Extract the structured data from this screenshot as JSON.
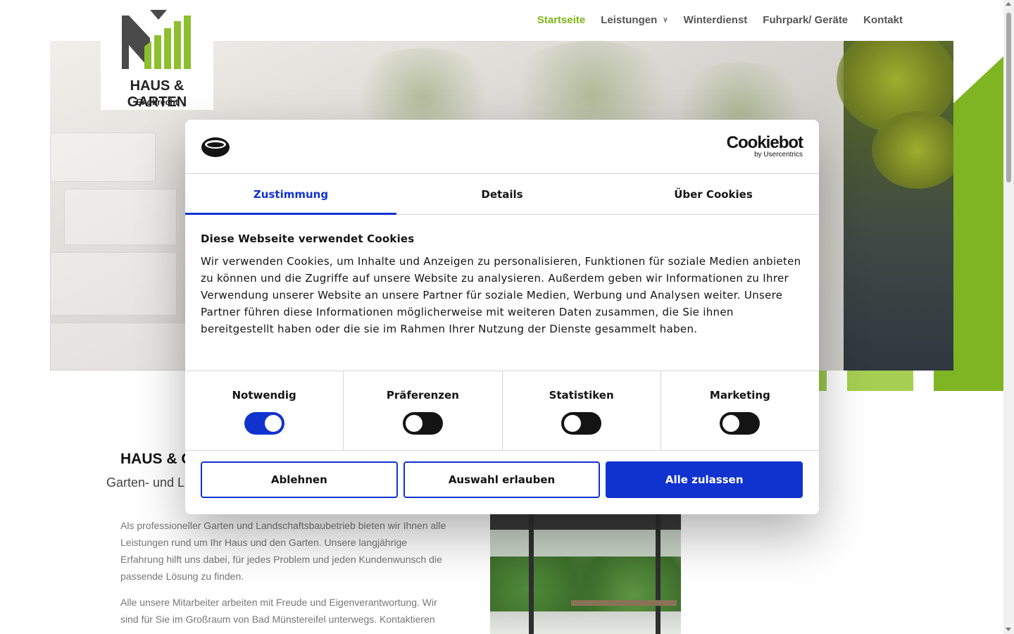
{
  "site": {
    "logo_title": "HAUS & GARTEN",
    "logo_subtitle": "Engbrecht",
    "nav": {
      "home": "Startseite",
      "services": "Leistungen",
      "winter": "Winterdienst",
      "fleet": "Fuhrpark/ Geräte",
      "contact": "Kontakt"
    },
    "accent_color": "#7cb518"
  },
  "page": {
    "heading": "HAUS & G",
    "subheading": "Garten- und L",
    "paragraph1": "Als professioneller Garten und Landschaftsbaubetrieb bieten wir Ihnen alle Leistungen rund um Ihr Haus und den Garten. Unsere langjährige Erfahrung hilft uns dabei, für jedes Problem und jeden Kundenwunsch die passende Lösung zu finden.",
    "paragraph2": "Alle unsere Mitarbeiter arbeiten mit Freude und Eigenverantwortung. Wir sind für Sie im Großraum von Bad Münstereifel unterwegs. Kontaktieren"
  },
  "cookie_dialog": {
    "brand": "Cookiebot",
    "brand_sub": "by Usercentrics",
    "tabs": {
      "consent": "Zustimmung",
      "details": "Details",
      "about": "Über Cookies"
    },
    "title": "Diese Webseite verwendet Cookies",
    "text": "Wir verwenden Cookies, um Inhalte und Anzeigen zu personalisieren, Funktionen für soziale Medien anbieten zu können und die Zugriffe auf unsere Website zu analysieren. Außerdem geben wir Informationen zu Ihrer Verwendung unserer Website an unsere Partner für soziale Medien, Werbung und Analysen weiter. Unsere Partner führen diese Informationen möglicherweise mit weiteren Daten zusammen, die Sie ihnen bereitgestellt haben oder die sie im Rahmen Ihrer Nutzung der Dienste gesammelt haben.",
    "categories": {
      "necessary": {
        "label": "Notwendig",
        "on": true
      },
      "preferences": {
        "label": "Präferenzen",
        "on": false
      },
      "statistics": {
        "label": "Statistiken",
        "on": false
      },
      "marketing": {
        "label": "Marketing",
        "on": false
      }
    },
    "buttons": {
      "decline": "Ablehnen",
      "allow_selection": "Auswahl erlauben",
      "allow_all": "Alle zulassen"
    },
    "accent_color": "#1032cf"
  }
}
